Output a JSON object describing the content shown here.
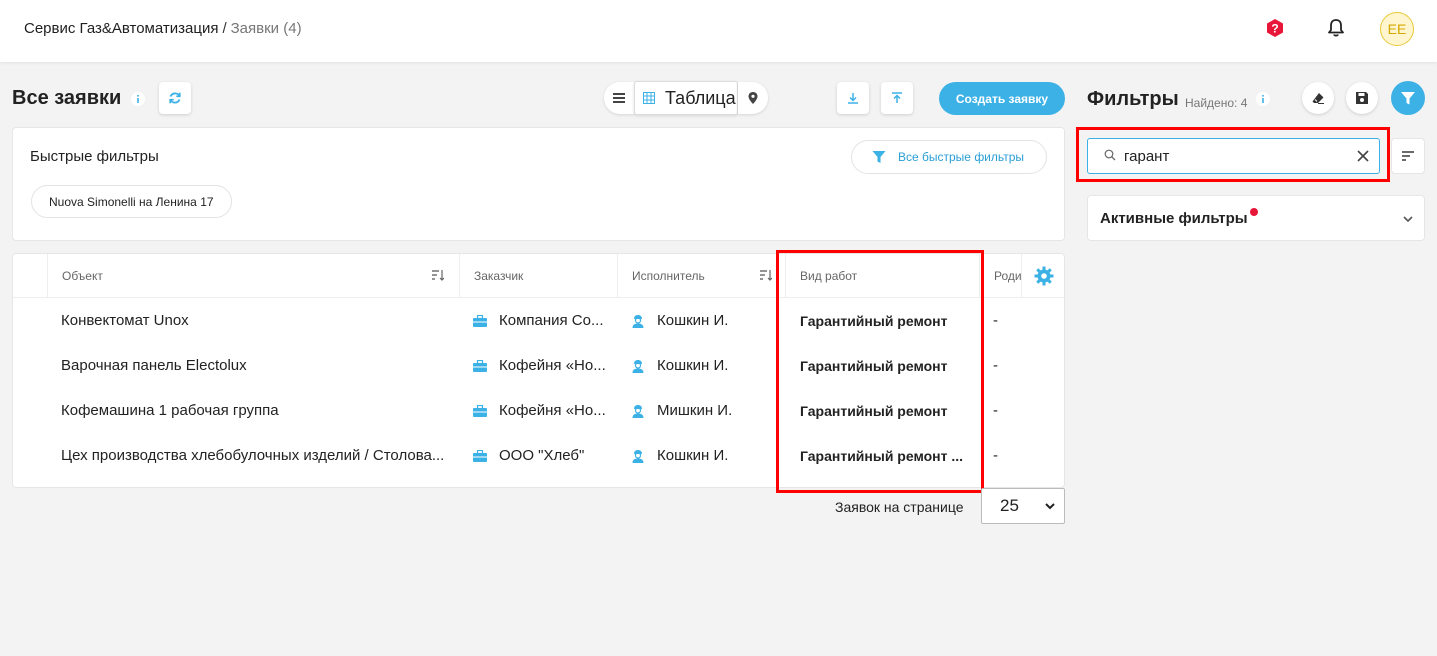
{
  "breadcrumb": {
    "main": "Сервис Газ&Автоматизация",
    "separator": "/",
    "current": "Заявки (4)"
  },
  "header": {
    "help_icon": "question-badge-icon",
    "bell_icon": "bell-icon",
    "avatar_initials": "EE"
  },
  "page": {
    "title": "Все заявки",
    "view_table_label": "Таблица",
    "create_button": "Создать заявку"
  },
  "quick_filters": {
    "title": "Быстрые фильтры",
    "all_button": "Все быстрые фильтры",
    "chips": [
      "Nuova Simonelli на Ленина 17"
    ]
  },
  "table": {
    "columns": [
      "Объект",
      "Заказчик",
      "Исполнитель",
      "Вид работ",
      "Роди"
    ],
    "rows": [
      {
        "object": "Конвектомат Unox",
        "customer": "Компания Со...",
        "executor": "Кошкин И.",
        "work_type": "Гарантийный ремонт",
        "extra": "-"
      },
      {
        "object": "Варочная панель Electolux",
        "customer": "Кофейня «Но...",
        "executor": "Кошкин И.",
        "work_type": "Гарантийный ремонт",
        "extra": "-"
      },
      {
        "object": "Кофемашина 1 рабочая группа",
        "customer": "Кофейня «Но...",
        "executor": "Мишкин И.",
        "work_type": "Гарантийный ремонт",
        "extra": "-"
      },
      {
        "object": "Цех производства хлебобулочных изделий / Столова...",
        "customer": "ООО \"Хлеб\"",
        "executor": "Кошкин И.",
        "work_type": "Гарантийный ремонт ...",
        "extra": "-"
      }
    ]
  },
  "pagination": {
    "per_page_label": "Заявок на странице",
    "per_page_value": "25"
  },
  "filters": {
    "title": "Фильтры",
    "found": "Найдено: 4",
    "search_value": "гарант",
    "active_filters_label": "Активные фильтры"
  },
  "colors": {
    "accent": "#3cb1e6",
    "highlight": "#ff0000",
    "alert_dot": "#e8173a"
  }
}
